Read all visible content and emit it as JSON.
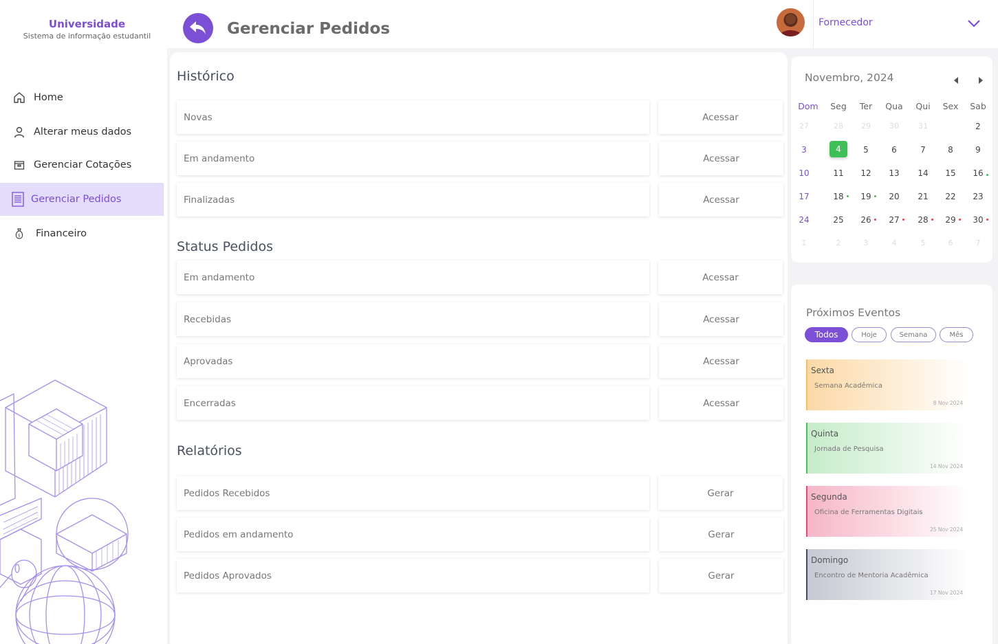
{
  "brand": {
    "title": "Universidade",
    "subtitle": "Sistema de informação estudantil"
  },
  "sidebar": {
    "items": [
      {
        "label": "Home",
        "icon": "home-icon"
      },
      {
        "label": "Alterar meus dados",
        "icon": "user-icon"
      },
      {
        "label": "Gerenciar Cotações",
        "icon": "box-icon"
      },
      {
        "label": "Gerenciar Pedidos",
        "icon": "document-icon",
        "active": true
      },
      {
        "label": "Financeiro",
        "icon": "money-bag-icon"
      }
    ]
  },
  "header": {
    "title": "Gerenciar Pedidos",
    "user_role": "Fornecedor"
  },
  "main": {
    "historico": {
      "title": "Histórico",
      "rows": [
        {
          "label": "Novas",
          "action": "Acessar"
        },
        {
          "label": "Em andamento",
          "action": "Acessar"
        },
        {
          "label": "Finalizadas",
          "action": "Acessar"
        }
      ]
    },
    "status": {
      "title": "Status Pedidos",
      "rows": [
        {
          "label": "Em andamento",
          "action": "Acessar"
        },
        {
          "label": "Recebidas",
          "action": "Acessar"
        },
        {
          "label": "Aprovadas",
          "action": "Acessar"
        },
        {
          "label": "Encerradas",
          "action": "Acessar"
        }
      ]
    },
    "relatorios": {
      "title": "Relatórios",
      "rows": [
        {
          "label": "Pedidos Recebidos",
          "action": "Gerar"
        },
        {
          "label": "Pedidos em andamento",
          "action": "Gerar"
        },
        {
          "label": "Pedidos Aprovados",
          "action": "Gerar"
        }
      ]
    }
  },
  "calendar": {
    "title": "Novembro, 2024",
    "weekdays": [
      "Dom",
      "Seg",
      "Ter",
      "Qua",
      "Qui",
      "Sex",
      "Sab"
    ],
    "weeks": [
      [
        "27",
        "28",
        "29",
        "30",
        "31",
        "",
        "2"
      ],
      [
        "3",
        "4",
        "5",
        "6",
        "7",
        "8",
        "9"
      ],
      [
        "10",
        "11",
        "12",
        "13",
        "14",
        "15",
        "16"
      ],
      [
        "17",
        "18",
        "19",
        "20",
        "21",
        "22",
        "23"
      ],
      [
        "24",
        "25",
        "26",
        "27",
        "28",
        "29",
        "30"
      ],
      [
        "1",
        "2",
        "3",
        "4",
        "5",
        "6",
        "7"
      ]
    ],
    "today": "4",
    "event_dots_green": [
      "16",
      "18",
      "19"
    ],
    "event_dots_red": [
      "26",
      "27",
      "28",
      "29",
      "30"
    ]
  },
  "events": {
    "title": "Próximos Eventos",
    "filters": [
      "Todos",
      "Hoje",
      "Semana",
      "Mês"
    ],
    "active_filter": "Todos",
    "items": [
      {
        "day": "Sexta",
        "name": "Semana Acadêmica",
        "date": "8 Nov 2024",
        "color": "#f5c061",
        "bg": "#fbd9a6"
      },
      {
        "day": "Quinta",
        "name": "Jornada de Pesquisa",
        "date": "14 Nov  2024",
        "color": "#4cc061",
        "bg": "#c6ecca"
      },
      {
        "day": "Segunda",
        "name": "Oficina de Ferramentas Digitais",
        "date": "25 Nov 2024",
        "color": "#e04a7a",
        "bg": "#f6b6c8"
      },
      {
        "day": "Domingo",
        "name": "Encontro de Mentoria Acadêmica",
        "date": "17 Nov 2024",
        "color": "#444a66",
        "bg": "#c6c9d2"
      }
    ]
  },
  "colors": {
    "accent": "#7b4fd6",
    "today": "#3fbf57",
    "event_red": "#e0404f"
  }
}
